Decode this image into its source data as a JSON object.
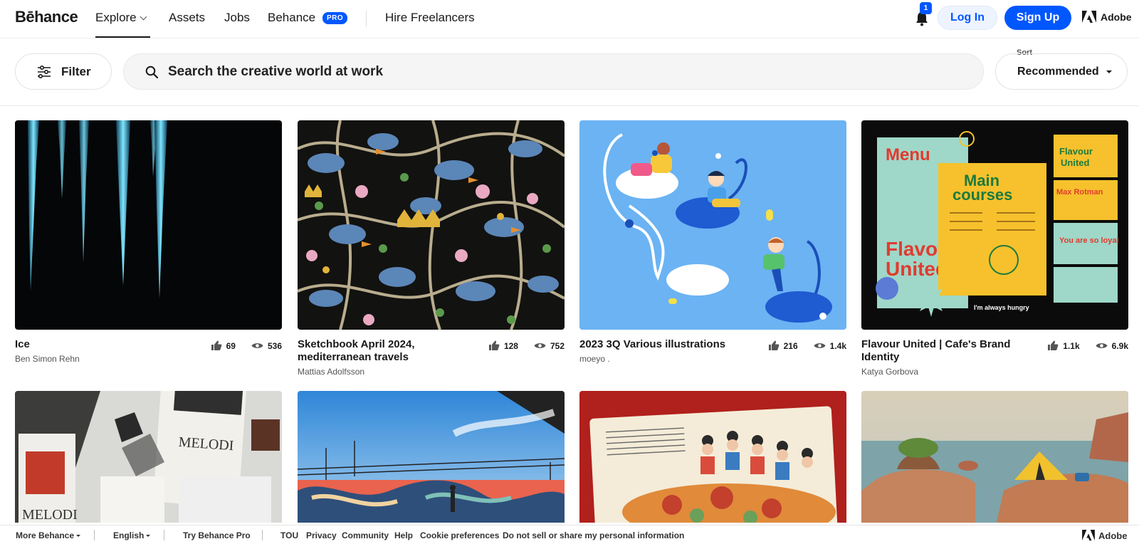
{
  "nav": {
    "logo": "Bēhance",
    "explore": "Explore",
    "assets": "Assets",
    "jobs": "Jobs",
    "behance": "Behance",
    "pro_badge": "PRO",
    "hire": "Hire Freelancers",
    "notification_count": "1",
    "login": "Log In",
    "signup": "Sign Up",
    "adobe": "Adobe",
    "icons": {
      "bell": "bell-icon",
      "chevron": "chevron-down-icon",
      "adobe": "adobe-logo-icon"
    },
    "accent": "#0057ff"
  },
  "toolbar": {
    "filter": "Filter",
    "search_placeholder": "Search the creative world at work",
    "sort_label": "Sort",
    "sort_value": "Recommended",
    "icons": {
      "filter": "sliders-icon",
      "search": "search-icon"
    }
  },
  "projects": [
    {
      "title": "Ice",
      "owner": "Ben Simon Rehn",
      "likes": "69",
      "views": "536"
    },
    {
      "title": "Sketchbook April 2024, mediterranean travels",
      "owner": "Mattias Adolfsson",
      "likes": "128",
      "views": "752"
    },
    {
      "title": "2023 3Q Various illustrations",
      "owner": "moeyo .",
      "likes": "216",
      "views": "1.4k"
    },
    {
      "title": "Flavour United | Cafe's Brand Identity",
      "owner": "Katya Gorbova",
      "likes": "1.1k",
      "views": "6.9k"
    }
  ],
  "artwork_text": {
    "menu": "Menu",
    "main": "Main",
    "courses": "courses",
    "flavour": "Flavour",
    "united": "United",
    "max": "Max Rotman",
    "loyal": "You are so loyal",
    "hungry": "I'm always hungry",
    "melodi": "MELODI"
  },
  "footer": {
    "more": "More Behance",
    "language": "English",
    "try_pro": "Try Behance Pro",
    "tou": "TOU",
    "privacy": "Privacy",
    "community": "Community",
    "help": "Help",
    "cookies": "Cookie preferences",
    "do_not_sell": "Do not sell or share my personal information",
    "adobe": "Adobe"
  }
}
